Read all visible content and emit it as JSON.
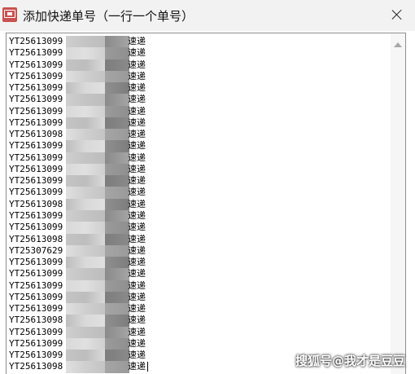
{
  "window": {
    "title": "添加快递单号（一行一个单号）"
  },
  "editor": {
    "lines": [
      {
        "prefix": "YT25613099",
        "suffix": "速递"
      },
      {
        "prefix": "YT25613099",
        "suffix": "速递"
      },
      {
        "prefix": "YT25613099",
        "suffix": "速递"
      },
      {
        "prefix": "YT25613099",
        "suffix": "速递"
      },
      {
        "prefix": "YT25613099",
        "suffix": "速递"
      },
      {
        "prefix": "YT25613099",
        "suffix": "速递"
      },
      {
        "prefix": "YT25613099",
        "suffix": "速递"
      },
      {
        "prefix": "YT25613099",
        "suffix": "速递"
      },
      {
        "prefix": "YT25613098",
        "suffix": "速递"
      },
      {
        "prefix": "YT25613099",
        "suffix": "速递"
      },
      {
        "prefix": "YT25613099",
        "suffix": "速递"
      },
      {
        "prefix": "YT25613099",
        "suffix": "速递"
      },
      {
        "prefix": "YT25613099",
        "suffix": "速递"
      },
      {
        "prefix": "YT25613099",
        "suffix": "速递"
      },
      {
        "prefix": "YT25613098",
        "suffix": "速递"
      },
      {
        "prefix": "YT25613099",
        "suffix": "速递"
      },
      {
        "prefix": "YT25613099",
        "suffix": "速递"
      },
      {
        "prefix": "YT25613098",
        "suffix": "速递"
      },
      {
        "prefix": "YT25307629",
        "suffix": "速递"
      },
      {
        "prefix": "YT25613099",
        "suffix": "速递"
      },
      {
        "prefix": "YT25613099",
        "suffix": "速递"
      },
      {
        "prefix": "YT25613099",
        "suffix": "速递"
      },
      {
        "prefix": "YT25613099",
        "suffix": "速递"
      },
      {
        "prefix": "YT25613099",
        "suffix": "速递"
      },
      {
        "prefix": "YT25613098",
        "suffix": "速递"
      },
      {
        "prefix": "YT25613099",
        "suffix": "速递"
      },
      {
        "prefix": "YT25613099",
        "suffix": "速递"
      },
      {
        "prefix": "YT25613099",
        "suffix": "速递"
      },
      {
        "prefix": "YT25613098",
        "suffix": "速递"
      }
    ]
  },
  "watermark": "搜狐号@我才是豆豆",
  "colors": {
    "titlebar": "#f2f2f2",
    "icon": "#c9514f",
    "mask_light": [
      "#cfcfcf",
      "#d9d9d9",
      "#c4c4c4",
      "#e0e0e0",
      "#bdbdbd"
    ],
    "mask_dark": [
      "#8a8a8a",
      "#9a9a9a",
      "#7d7d7d",
      "#a5a5a5",
      "#8f8f8f"
    ]
  },
  "icons": {
    "app": "app-icon",
    "close": "close-icon",
    "scroll_up": "chevron-up-icon"
  }
}
